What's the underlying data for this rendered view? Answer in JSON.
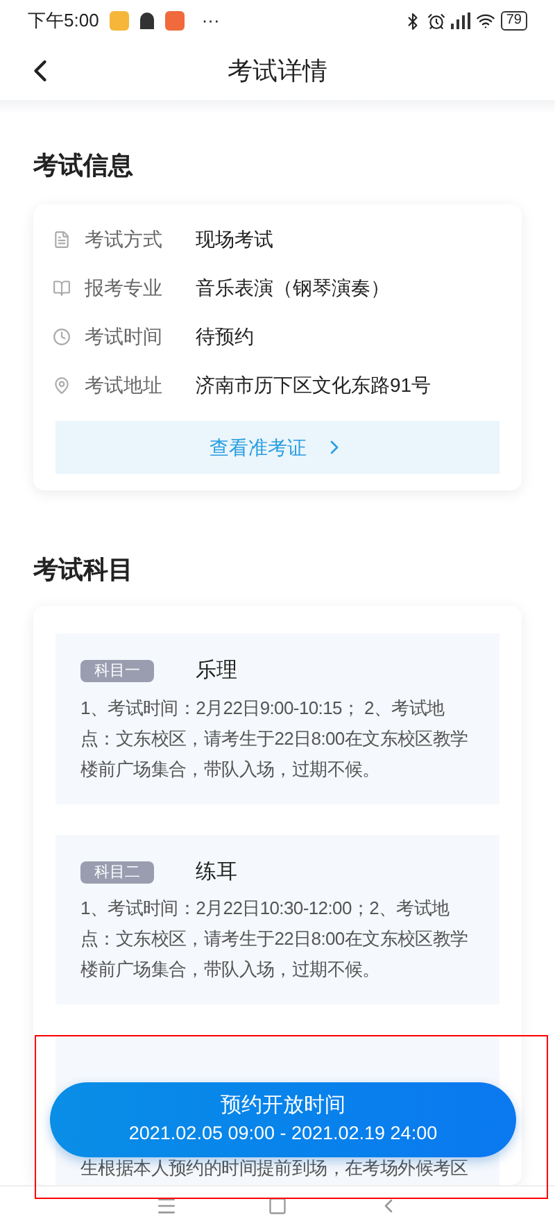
{
  "status_bar": {
    "time": "下午5:00",
    "more": "···",
    "battery": "79"
  },
  "header": {
    "title": "考试详情"
  },
  "exam_info": {
    "heading": "考试信息",
    "rows": [
      {
        "kind": "doc",
        "label": "考试方式",
        "value": "现场考试"
      },
      {
        "kind": "book",
        "label": "报考专业",
        "value": "音乐表演（钢琴演奏）"
      },
      {
        "kind": "clock",
        "label": "考试时间",
        "value": "待预约"
      },
      {
        "kind": "pin",
        "label": "考试地址",
        "value": "济南市历下区文化东路91号"
      }
    ],
    "ticket_button": "查看准考证"
  },
  "subjects": {
    "heading": "考试科目",
    "items": [
      {
        "badge": "科目一",
        "name": "乐理",
        "detail": "1、考试时间：2月22日9:00-10:15； 2、考试地点：文东校区，请考生于22日8:00在文东校区教学楼前广场集合，带队入场，过期不候。"
      },
      {
        "badge": "科目二",
        "name": "练耳",
        "detail": "1、考试时间：2月22日10:30-12:00；2、考试地点：文东校区，请考生于22日8:00在文东校区教学楼前广场集合，带队入场，过期不候。"
      },
      {
        "detail": "生根据本人预约的时间提前到场，在考场外候考区"
      }
    ]
  },
  "booking_button": {
    "title": "预约开放时间",
    "period": "2021.02.05 09:00 - 2021.02.19 24:00"
  }
}
